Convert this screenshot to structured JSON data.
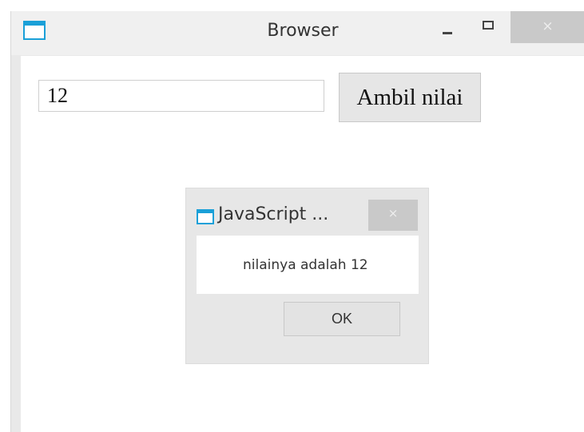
{
  "window": {
    "title": "Browser",
    "icon": "app-window-icon",
    "controls": {
      "minimize": "–",
      "maximize": "☐",
      "close": "×"
    }
  },
  "form": {
    "input_value": "12",
    "button_label": "Ambil nilai"
  },
  "dialog": {
    "title": "JavaScript ...",
    "close": "×",
    "message": "nilainya adalah 12",
    "ok_label": "OK"
  },
  "colors": {
    "accent": "#1aa0d8",
    "titlebar": "#f0f0f0",
    "close_button": "#c9c9c9"
  }
}
